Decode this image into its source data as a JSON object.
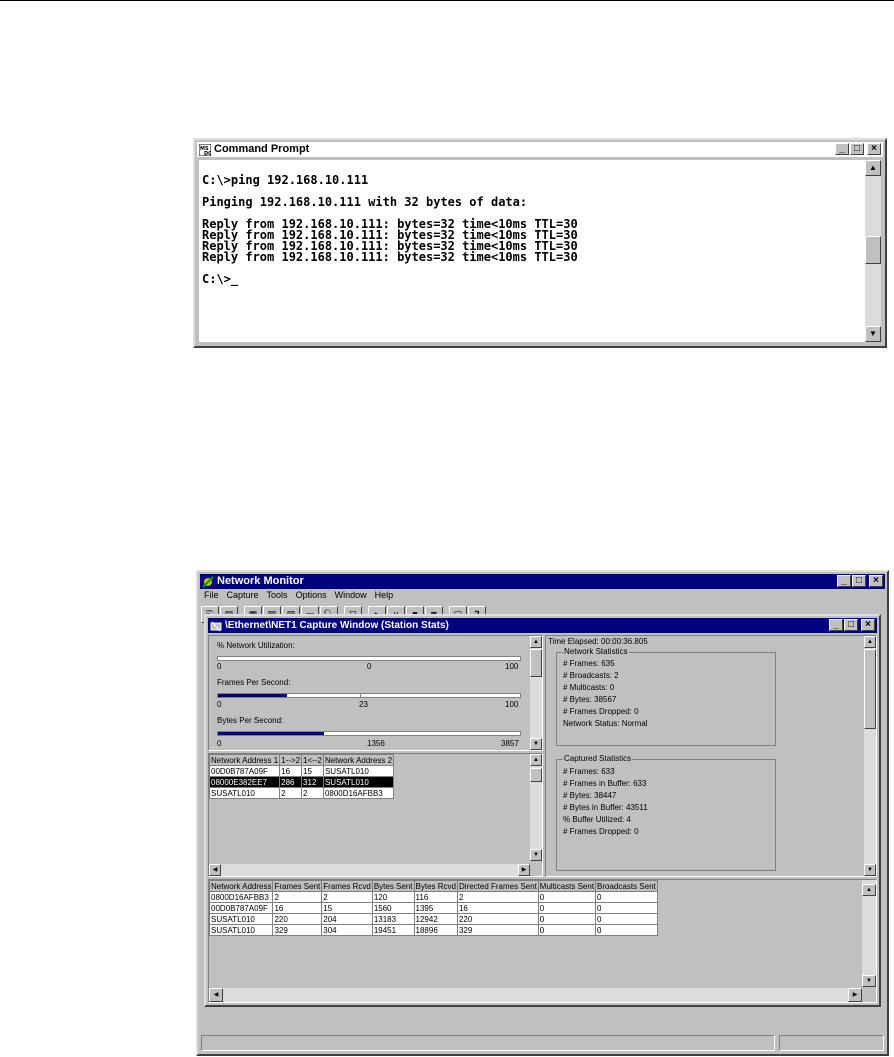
{
  "command_prompt": {
    "title": "Command Prompt",
    "lines": [
      "",
      "C:\\>ping 192.168.10.111",
      "",
      "Pinging 192.168.10.111 with 32 bytes of data:",
      "",
      "Reply from 192.168.10.111: bytes=32 time<10ms TTL=30",
      "Reply from 192.168.10.111: bytes=32 time<10ms TTL=30",
      "Reply from 192.168.10.111: bytes=32 time<10ms TTL=30",
      "Reply from 192.168.10.111: bytes=32 time<10ms TTL=30",
      "",
      "C:\\>_"
    ]
  },
  "network_monitor": {
    "title": "Network Monitor",
    "menu": [
      "File",
      "Capture",
      "Tools",
      "Options",
      "Window",
      "Help"
    ],
    "toolbar_icons": [
      "open-icon",
      "save-icon",
      "print-icon",
      "copy-icon",
      "paste-icon",
      "print-preview-icon",
      "find-icon",
      "filter-icon",
      "start-icon",
      "pause-icon",
      "stop-icon",
      "stop-view-icon",
      "display-icon",
      "help-icon"
    ],
    "help_label": "?",
    "capture_window": {
      "title": "\\Ethernet\\NET1 Capture Window (Station Stats)",
      "gauges": [
        {
          "label": "% Network Utilization:",
          "min": "0",
          "mid": "0",
          "max": "100",
          "value": 0
        },
        {
          "label": "Frames Per Second:",
          "min": "0",
          "mid": "23",
          "max": "100",
          "value": 23
        },
        {
          "label": "Bytes Per Second:",
          "min": "0",
          "mid": "1356",
          "max": "3857",
          "value": 1356
        }
      ],
      "pair_table": {
        "headers": [
          "Network Address 1",
          "1-->2",
          "1<--2",
          "Network Address 2"
        ],
        "rows": [
          [
            "00D0B787A09F",
            "16",
            "15",
            "SUSATL010"
          ],
          [
            "08000E382EE7",
            "286",
            "312",
            "SUSATL010"
          ],
          [
            "SUSATL010",
            "2",
            "2",
            "0800D16AFBB3"
          ]
        ],
        "selected_row": 1
      },
      "time_elapsed": "Time Elapsed: 00:00:36.805",
      "network_statistics": {
        "label": "Network Statistics",
        "items": [
          "# Frames: 635",
          "# Broadcasts: 2",
          "# Multicasts: 0",
          "# Bytes: 38567",
          "# Frames Dropped: 0",
          "Network Status: Normal"
        ]
      },
      "captured_statistics": {
        "label": "Captured Statistics",
        "items": [
          "# Frames: 633",
          "# Frames in Buffer: 633",
          "# Bytes: 38447",
          "# Bytes in Buffer: 43511",
          "% Buffer Utilized: 4",
          "# Frames Dropped: 0"
        ]
      },
      "station_table": {
        "headers": [
          "Network Address",
          "Frames Sent",
          "Frames Rcvd",
          "Bytes Sent",
          "Bytes Rcvd",
          "Directed Frames Sent",
          "Multicasts Sent",
          "Broadcasts Sent"
        ],
        "rows": [
          [
            "0800D16AFBB3",
            "2",
            "2",
            "120",
            "116",
            "2",
            "0",
            "0"
          ],
          [
            "00D0B787A09F",
            "16",
            "15",
            "1560",
            "1395",
            "16",
            "0",
            "0"
          ],
          [
            "SUSATL010",
            "220",
            "204",
            "13183",
            "12942",
            "220",
            "0",
            "0"
          ],
          [
            "SUSATL010",
            "329",
            "304",
            "19451",
            "18896",
            "329",
            "0",
            "0"
          ]
        ]
      }
    }
  }
}
